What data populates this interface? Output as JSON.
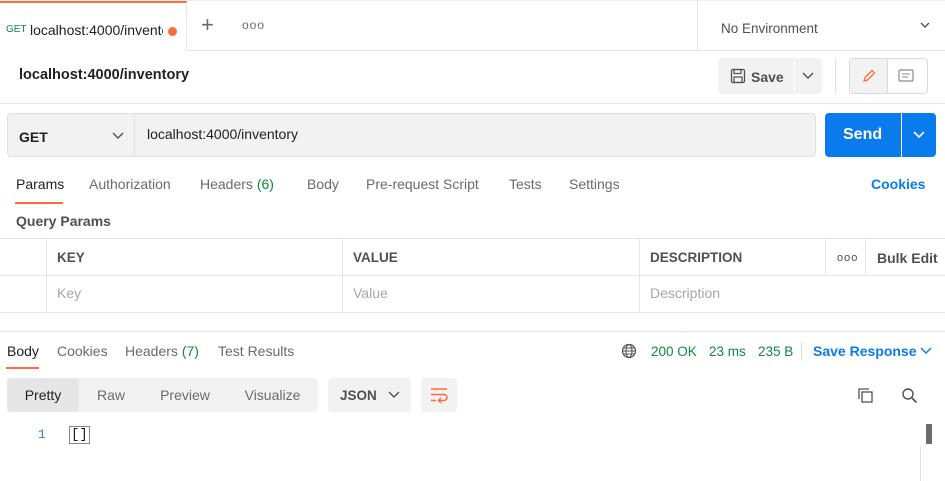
{
  "tabbar": {
    "active_tab": {
      "method": "GET",
      "title": "localhost:4000/inventc",
      "has_unsaved": true
    },
    "add_icon": "plus-icon",
    "more_icon": "more-dots-icon",
    "environment": "No Environment"
  },
  "request": {
    "title": "localhost:4000/inventory",
    "save_label": "Save",
    "method": "GET",
    "url": "localhost:4000/inventory",
    "send_label": "Send"
  },
  "request_tabs": {
    "params": "Params",
    "authorization": "Authorization",
    "headers": "Headers",
    "headers_count": "(6)",
    "body": "Body",
    "pre_request": "Pre-request Script",
    "tests": "Tests",
    "settings": "Settings",
    "cookies": "Cookies"
  },
  "query_params": {
    "title": "Query Params",
    "columns": [
      "KEY",
      "VALUE",
      "DESCRIPTION"
    ],
    "bulk_edit": "Bulk Edit",
    "placeholders": {
      "key": "Key",
      "value": "Value",
      "description": "Description"
    }
  },
  "response": {
    "tabs": {
      "body": "Body",
      "cookies": "Cookies",
      "headers": "Headers",
      "headers_count": "(7)",
      "test_results": "Test Results"
    },
    "status": "200 OK",
    "time": "23 ms",
    "size": "235 B",
    "save_response": "Save Response",
    "views": [
      "Pretty",
      "Raw",
      "Preview",
      "Visualize"
    ],
    "active_view": "Pretty",
    "format": "JSON",
    "code_lines": [
      {
        "num": "1",
        "text": "[]"
      }
    ]
  },
  "colors": {
    "accent_orange": "#ff6c37",
    "primary_blue": "#097bed",
    "success_green": "#0c8a43"
  }
}
